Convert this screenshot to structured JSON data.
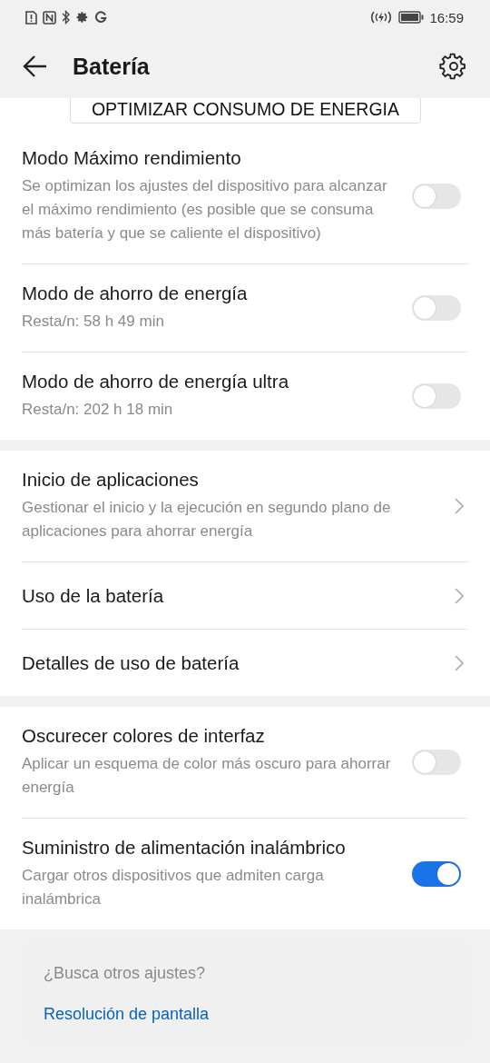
{
  "status_bar": {
    "time": "16:59"
  },
  "header": {
    "title": "Batería"
  },
  "optimize_button": {
    "label": "OPTIMIZAR CONSUMO DE ENERGIA"
  },
  "sections": [
    {
      "items": [
        {
          "kind": "toggle",
          "title": "Modo Máximo rendimiento",
          "subtitle": "Se optimizan los ajustes del dispositivo para alcanzar el máximo rendimiento (es posible que se consuma más batería y que se caliente el dispositivo)",
          "on": false
        },
        {
          "kind": "toggle",
          "title": "Modo de ahorro de energía",
          "subtitle": "Resta/n: 58 h 49 min",
          "on": false
        },
        {
          "kind": "toggle",
          "title": "Modo de ahorro de energía ultra",
          "subtitle": "Resta/n: 202 h 18 min",
          "on": false
        }
      ]
    },
    {
      "items": [
        {
          "kind": "link",
          "title": "Inicio de aplicaciones",
          "subtitle": "Gestionar el inicio y la ejecución en segundo plano de aplicaciones para ahorrar energía"
        },
        {
          "kind": "link",
          "title": "Uso de la batería"
        },
        {
          "kind": "link",
          "title": "Detalles de uso de batería"
        }
      ]
    },
    {
      "items": [
        {
          "kind": "toggle",
          "title": "Oscurecer colores de interfaz",
          "subtitle": "Aplicar un esquema de color más oscuro para ahorrar energía",
          "on": false
        },
        {
          "kind": "toggle",
          "title": "Suministro de alimentación inalámbrico",
          "subtitle": "Cargar otros dispositivos que admiten carga inalámbrica",
          "on": true
        }
      ]
    }
  ],
  "suggestion_card": {
    "question": "¿Busca otros ajustes?",
    "link": "Resolución de pantalla"
  }
}
